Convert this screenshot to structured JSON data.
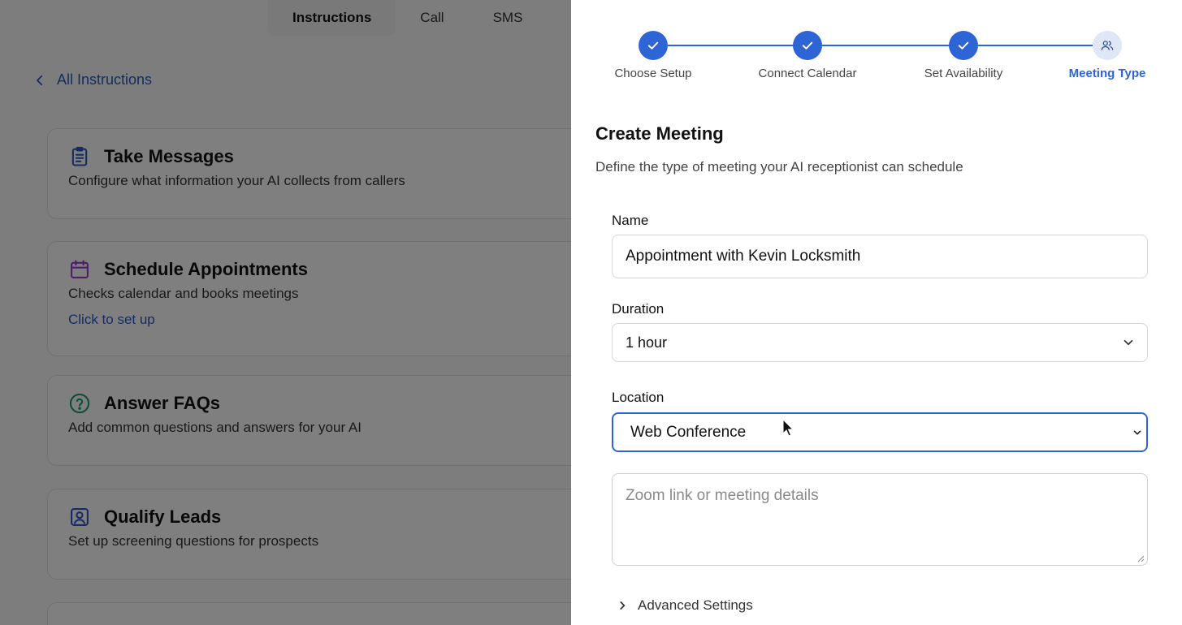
{
  "background": {
    "tabs": [
      {
        "label": "Instructions",
        "active": true
      },
      {
        "label": "Call",
        "active": false
      },
      {
        "label": "SMS",
        "active": false
      }
    ],
    "back_link": "All Instructions",
    "cards": [
      {
        "icon": "clipboard-icon",
        "title": "Take Messages",
        "desc": "Configure what information your AI collects from callers",
        "link": ""
      },
      {
        "icon": "calendar-icon",
        "title": "Schedule Appointments",
        "desc": "Checks calendar and books meetings",
        "link": "Click to set up"
      },
      {
        "icon": "question-circle-icon",
        "title": "Answer FAQs",
        "desc": "Add common questions and answers for your AI",
        "link": ""
      },
      {
        "icon": "user-badge-icon",
        "title": "Qualify Leads",
        "desc": "Set up screening questions for prospects",
        "link": ""
      }
    ]
  },
  "stepper": {
    "steps": [
      {
        "label": "Choose Setup",
        "status": "done"
      },
      {
        "label": "Connect Calendar",
        "status": "done"
      },
      {
        "label": "Set Availability",
        "status": "done"
      },
      {
        "label": "Meeting Type",
        "status": "current"
      }
    ]
  },
  "form": {
    "title": "Create Meeting",
    "subtitle": "Define the type of meeting your AI receptionist can schedule",
    "name_label": "Name",
    "name_value": "Appointment with Kevin Locksmith",
    "duration_label": "Duration",
    "duration_value": "1 hour",
    "location_label": "Location",
    "location_value": "Web Conference",
    "details_placeholder": "Zoom link or meeting details",
    "advanced_label": "Advanced Settings"
  },
  "colors": {
    "accent": "#2d64d6",
    "link": "#2b57c8",
    "overlay": "rgba(0,0,0,0.50)"
  }
}
